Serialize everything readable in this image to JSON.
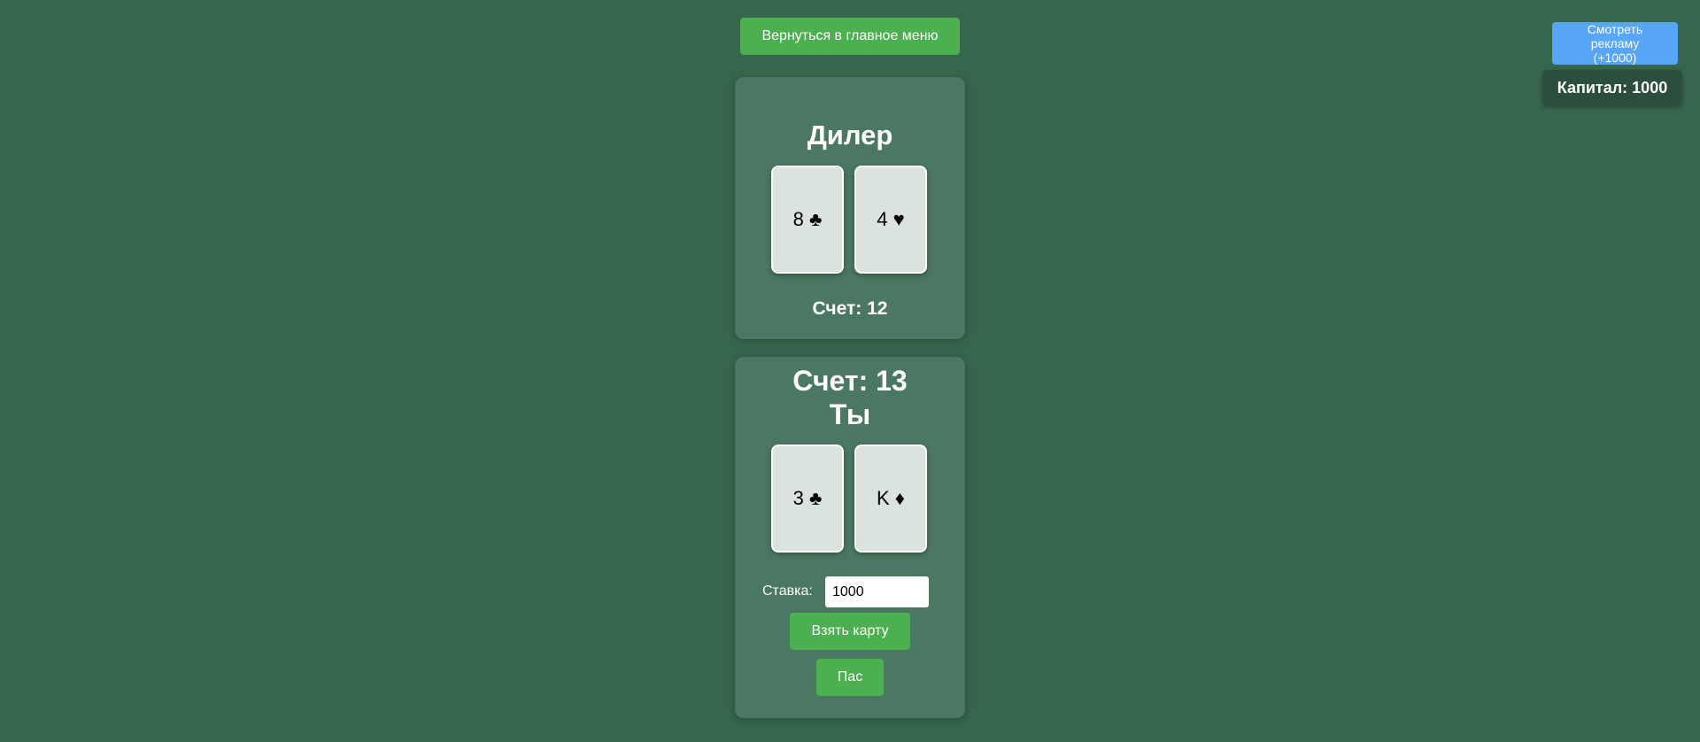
{
  "nav": {
    "back_label": "Вернуться в главное меню"
  },
  "ad": {
    "label": "Смотреть рекламу (+1000)"
  },
  "capital": {
    "text": "Капитал: 1000"
  },
  "dealer": {
    "title": "Дилер",
    "cards": [
      {
        "rank": "8",
        "suit": "♣"
      },
      {
        "rank": "4",
        "suit": "♥"
      }
    ],
    "score": "Счет: 12"
  },
  "player": {
    "score": "Счет: 13",
    "title": "Ты",
    "cards": [
      {
        "rank": "3",
        "suit": "♣"
      },
      {
        "rank": "K",
        "suit": "♦"
      }
    ],
    "stake_label": "Ставка:",
    "stake_value": "1000",
    "hit_label": "Взять карту",
    "stand_label": "Пас"
  },
  "colors": {
    "background": "#37664f",
    "panel": "#4b7862",
    "button": "#4caf50",
    "ad_button": "#57a6f7",
    "capital_box": "#2b4f3c"
  }
}
